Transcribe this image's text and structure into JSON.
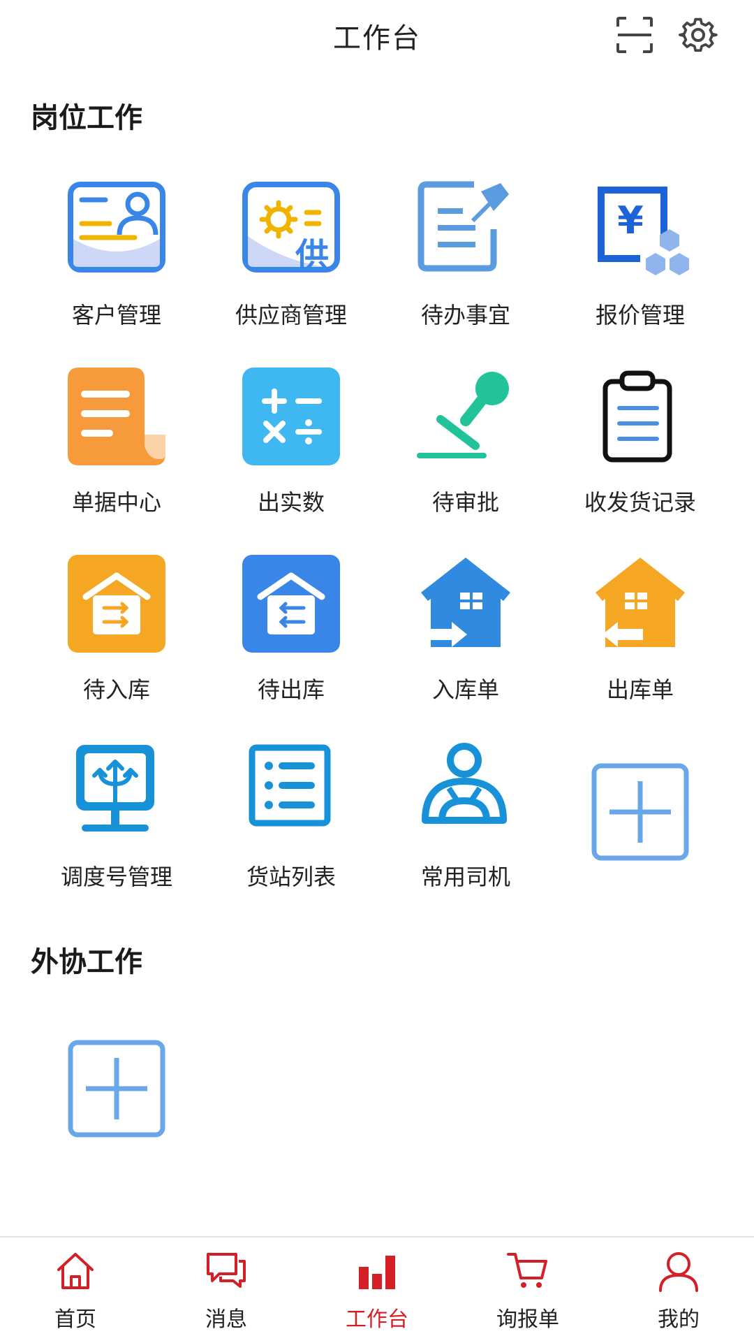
{
  "header": {
    "title": "工作台",
    "scan_icon": "scan-icon",
    "settings_icon": "gear-icon"
  },
  "sections": [
    {
      "title": "岗位工作",
      "items": [
        {
          "label": "客户管理",
          "icon": "customer-card-icon"
        },
        {
          "label": "供应商管理",
          "icon": "supplier-icon"
        },
        {
          "label": "待办事宜",
          "icon": "todo-edit-icon"
        },
        {
          "label": "报价管理",
          "icon": "quote-yen-icon"
        },
        {
          "label": "单据中心",
          "icon": "document-icon"
        },
        {
          "label": "出实数",
          "icon": "calculator-icon"
        },
        {
          "label": "待审批",
          "icon": "stamp-icon"
        },
        {
          "label": "收发货记录",
          "icon": "clipboard-icon"
        },
        {
          "label": "待入库",
          "icon": "warehouse-in-icon"
        },
        {
          "label": "待出库",
          "icon": "warehouse-out-icon"
        },
        {
          "label": "入库单",
          "icon": "inbound-house-icon"
        },
        {
          "label": "出库单",
          "icon": "outbound-house-icon"
        },
        {
          "label": "调度号管理",
          "icon": "dispatch-icon"
        },
        {
          "label": "货站列表",
          "icon": "list-icon"
        },
        {
          "label": "常用司机",
          "icon": "driver-icon"
        },
        {
          "label": "",
          "icon": "add-icon"
        }
      ]
    },
    {
      "title": "外协工作",
      "items": [
        {
          "label": "",
          "icon": "add-icon"
        }
      ]
    }
  ],
  "tabbar": {
    "items": [
      {
        "label": "首页",
        "icon": "home-icon"
      },
      {
        "label": "消息",
        "icon": "message-icon"
      },
      {
        "label": "工作台",
        "icon": "bar-chart-icon",
        "active": true
      },
      {
        "label": "询报单",
        "icon": "cart-icon"
      },
      {
        "label": "我的",
        "icon": "user-icon"
      }
    ]
  },
  "colors": {
    "accent": "#d51f26",
    "blue": "#3a86e8",
    "orange": "#f5a623"
  }
}
